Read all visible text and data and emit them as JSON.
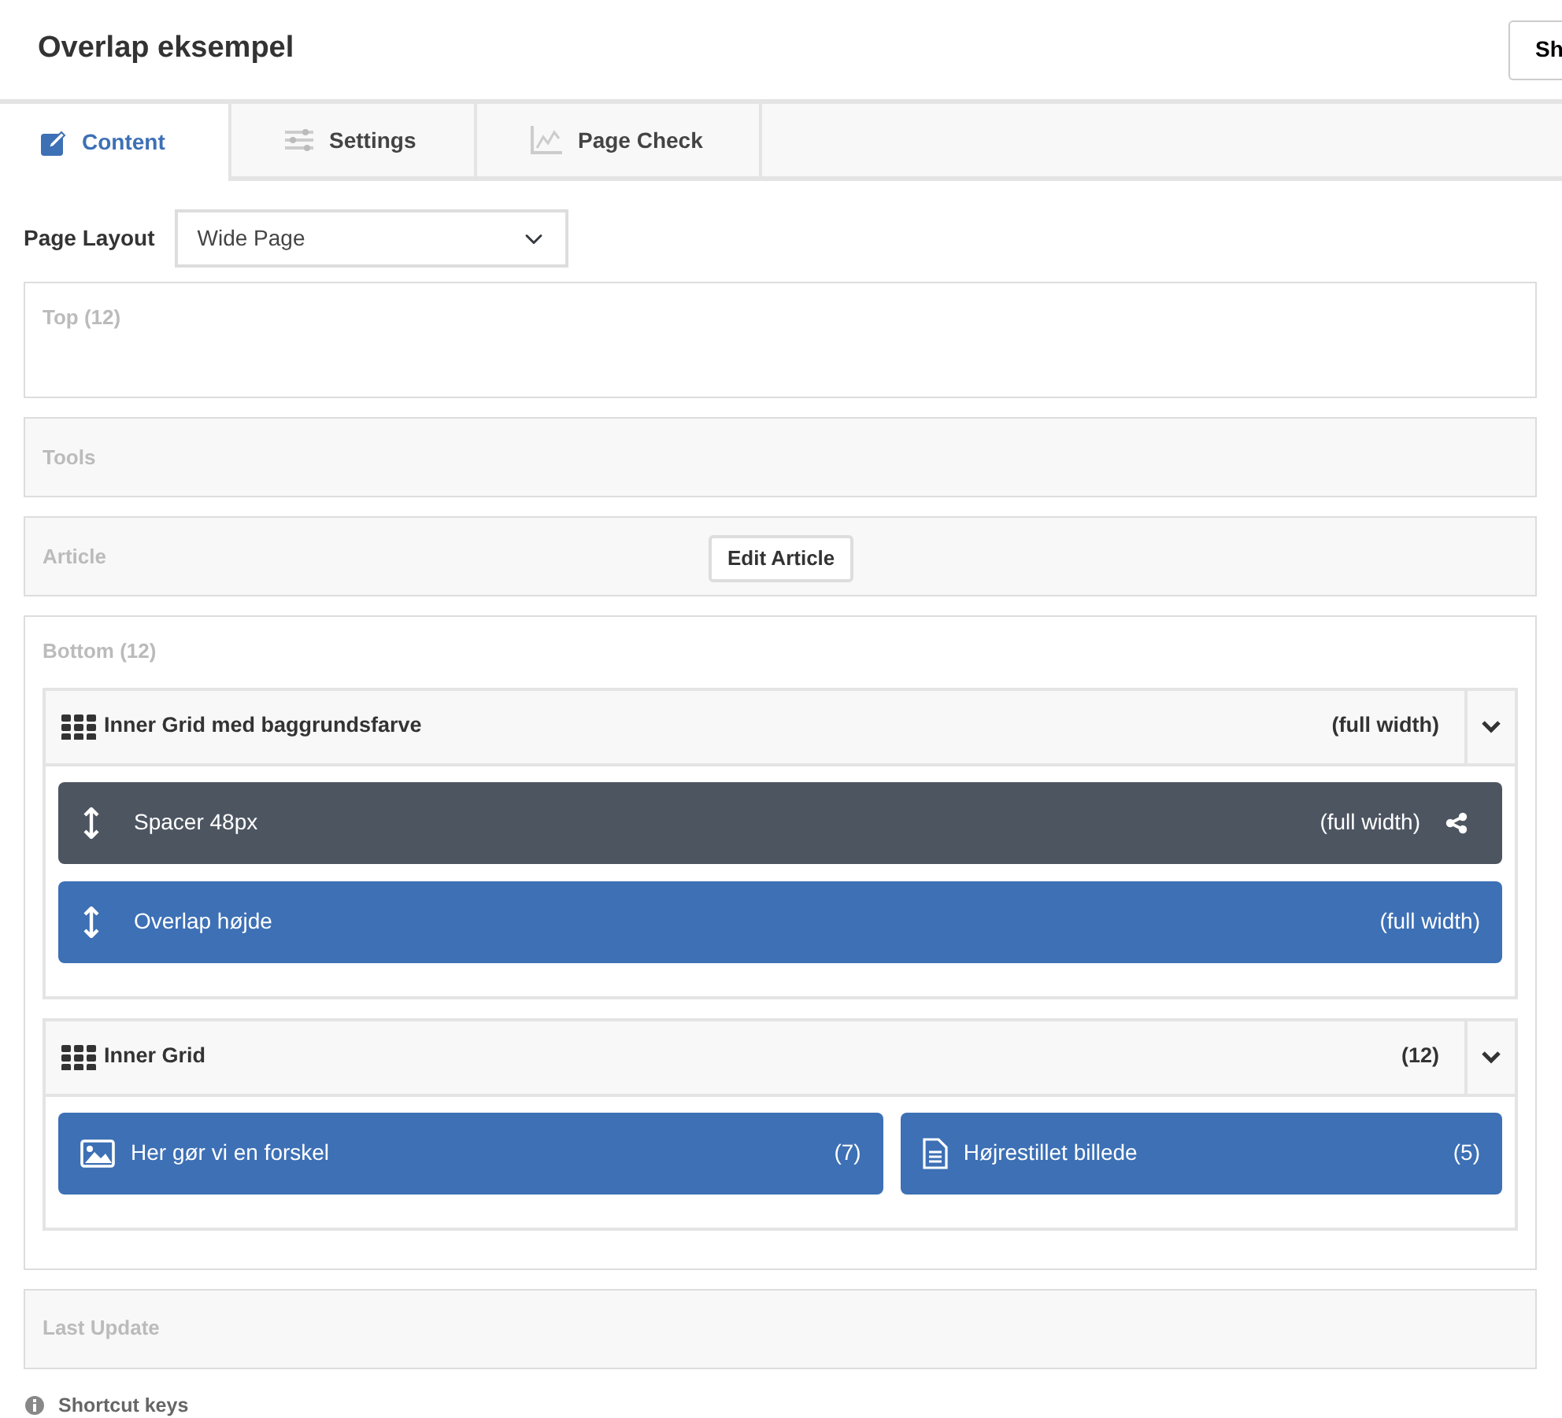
{
  "title": "Overlap eksempel",
  "header_button": "Sh",
  "tabs": [
    {
      "label": "Content",
      "selected": true
    },
    {
      "label": "Settings",
      "selected": false
    },
    {
      "label": "Page Check",
      "selected": false
    }
  ],
  "page_layout": {
    "label": "Page Layout",
    "value": "Wide Page"
  },
  "sections": [
    {
      "kind": "open",
      "label": "Top (12)"
    },
    {
      "kind": "zone",
      "label": "Tools"
    },
    {
      "kind": "article",
      "label": "Article",
      "button": "Edit Article"
    },
    {
      "kind": "bottom",
      "label": "Bottom (12)",
      "grids": [
        {
          "title": "Inner Grid med baggrundsfarve",
          "size": "(full width)",
          "blocks": [
            {
              "kind": "spacer",
              "label": "Spacer 48px",
              "size": "(full width)",
              "color": "#4d5561",
              "shared": true
            },
            {
              "kind": "spacer",
              "label": "Overlap højde",
              "size": "(full width)",
              "color": "#3d70b5",
              "shared": false
            }
          ]
        },
        {
          "title": "Inner Grid",
          "size": "(12)",
          "blocks": [
            {
              "kind": "image",
              "label": "Her gør vi en forskel",
              "size": "(7)",
              "color": "#3d70b5",
              "shared": false
            },
            {
              "kind": "text",
              "label": "Højrestillet billede",
              "size": "(5)",
              "color": "#3d70b5",
              "shared": false
            }
          ]
        }
      ]
    },
    {
      "kind": "zone",
      "label": "Last Update"
    }
  ],
  "footer": "Shortcut keys"
}
